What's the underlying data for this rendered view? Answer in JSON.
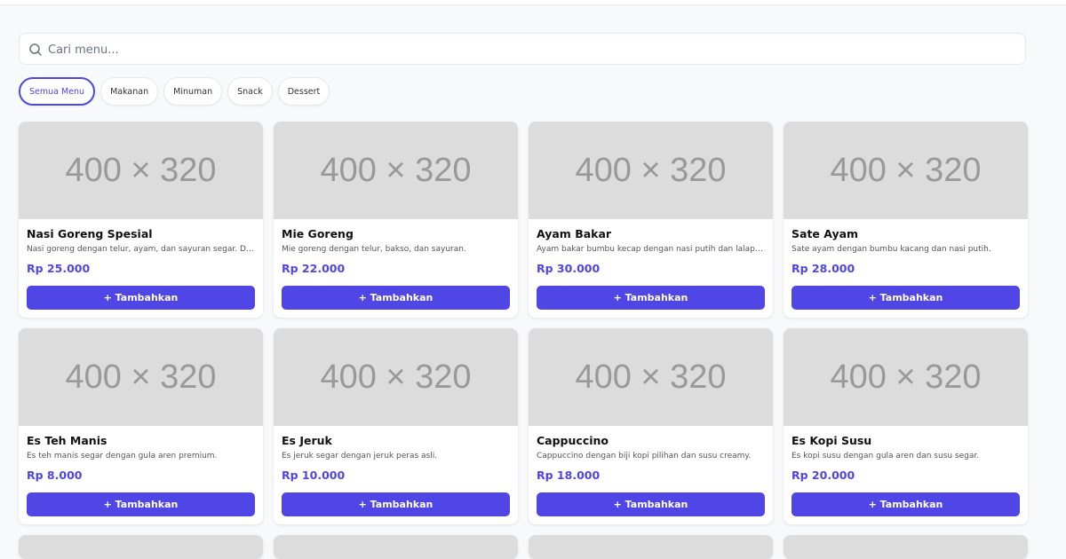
{
  "search": {
    "placeholder": "Cari menu..."
  },
  "categories": [
    {
      "label": "Semua Menu",
      "active": true
    },
    {
      "label": "Makanan"
    },
    {
      "label": "Minuman"
    },
    {
      "label": "Snack"
    },
    {
      "label": "Dessert"
    }
  ],
  "products": [
    {
      "image": "400 × 320",
      "name": "Nasi Goreng Spesial",
      "description": "Nasi goreng dengan telur, ayam, dan sayuran segar. Disajikan dengan kerupuk.",
      "price": "Rp 25.000",
      "button": "+ Tambahkan"
    },
    {
      "image": "400 × 320",
      "name": "Mie Goreng",
      "description": "Mie goreng dengan telur, bakso, dan sayuran.",
      "price": "Rp 22.000",
      "button": "+ Tambahkan"
    },
    {
      "image": "400 × 320",
      "name": "Ayam Bakar",
      "description": "Ayam bakar bumbu kecap dengan nasi putih dan lalapan.",
      "price": "Rp 30.000",
      "button": "+ Tambahkan"
    },
    {
      "image": "400 × 320",
      "name": "Sate Ayam",
      "description": "Sate ayam dengan bumbu kacang dan nasi putih.",
      "price": "Rp 28.000",
      "button": "+ Tambahkan"
    },
    {
      "image": "400 × 320",
      "name": "Es Teh Manis",
      "description": "Es teh manis segar dengan gula aren premium.",
      "price": "Rp 8.000",
      "button": "+ Tambahkan"
    },
    {
      "image": "400 × 320",
      "name": "Es Jeruk",
      "description": "Es jeruk segar dengan jeruk peras asli.",
      "price": "Rp 10.000",
      "button": "+ Tambahkan"
    },
    {
      "image": "400 × 320",
      "name": "Cappuccino",
      "description": "Cappuccino dengan biji kopi pilihan dan susu creamy.",
      "price": "Rp 18.000",
      "button": "+ Tambahkan"
    },
    {
      "image": "400 × 320",
      "name": "Es Kopi Susu",
      "description": "Es kopi susu dengan gula aren dan susu segar.",
      "price": "Rp 20.000",
      "button": "+ Tambahkan"
    }
  ],
  "colors": {
    "accent": "#4f46e5",
    "placeholder_bg": "#dcdcdc",
    "page_bg": "#f8f9fb"
  }
}
